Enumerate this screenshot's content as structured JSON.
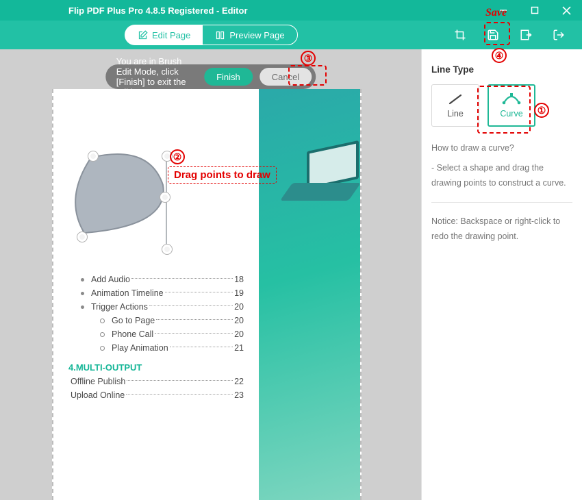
{
  "titlebar": {
    "title": "Flip PDF Plus Pro 4.8.5 Registered - Editor"
  },
  "toolbar": {
    "edit_tab": "Edit Page",
    "preview_tab": "Preview Page"
  },
  "modebar": {
    "message": "You are in Brush Edit Mode, click [Finish] to exit the editing area",
    "finish": "Finish",
    "cancel": "Cancel"
  },
  "content": {
    "items1": [
      {
        "label": "Add Audio",
        "page": "18"
      },
      {
        "label": "Animation Timeline",
        "page": "19"
      },
      {
        "label": "Trigger Actions",
        "page": "20"
      }
    ],
    "sub_items": [
      {
        "label": "Go to Page",
        "page": "20"
      },
      {
        "label": "Phone Call",
        "page": "20"
      },
      {
        "label": "Play Animation",
        "page": "21"
      }
    ],
    "section_title": "4.MULTI-OUTPUT",
    "items2": [
      {
        "label": "Offline Publish",
        "page": "22"
      },
      {
        "label": "Upload Online",
        "page": "23"
      }
    ]
  },
  "side": {
    "title": "Line Type",
    "line": "Line",
    "curve": "Curve",
    "help_q": "How to draw a curve?",
    "help_body": "- Select a shape and drag the drawing points to construct a curve.",
    "notice": "Notice: Backspace or right-click to redo the drawing point."
  },
  "annotations": {
    "save": "Save",
    "drag": "Drag points to draw"
  }
}
